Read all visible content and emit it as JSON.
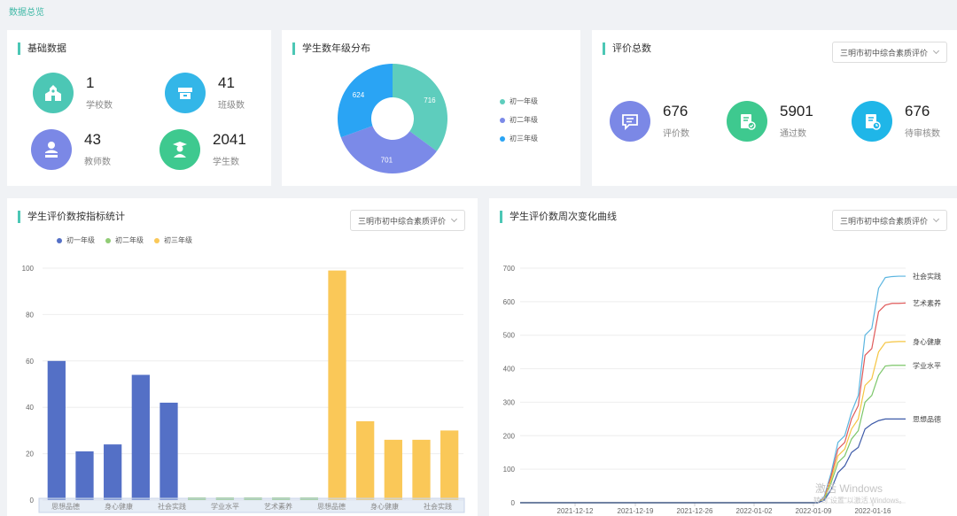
{
  "page": {
    "title": "数据总览"
  },
  "basic": {
    "title": "基础数据",
    "items": [
      {
        "value": "1",
        "label": "学校数",
        "color": "#4cc7b5",
        "icon": "school-icon"
      },
      {
        "value": "41",
        "label": "班级数",
        "color": "#33b6e8",
        "icon": "classroom-icon"
      },
      {
        "value": "43",
        "label": "教师数",
        "color": "#7b88e6",
        "icon": "teacher-icon"
      },
      {
        "value": "2041",
        "label": "学生数",
        "color": "#3ec98f",
        "icon": "student-icon"
      }
    ]
  },
  "distribution": {
    "title": "学生数年级分布",
    "legend": [
      "初一年级",
      "初二年级",
      "初三年级"
    ],
    "chart_data": {
      "type": "pie",
      "labels": [
        "初一年级",
        "初二年级",
        "初三年级"
      ],
      "values": [
        716,
        701,
        624
      ],
      "colors": [
        "#5ecdbd",
        "#7b8ae8",
        "#2aa4f4"
      ]
    }
  },
  "eval": {
    "title": "评价总数",
    "select": "三明市初中综合素质评价",
    "items": [
      {
        "value": "676",
        "label": "评价数",
        "color": "#7b88e6",
        "icon": "comment-icon"
      },
      {
        "value": "5901",
        "label": "通过数",
        "color": "#3ec98f",
        "icon": "approved-doc-icon"
      },
      {
        "value": "676",
        "label": "待审核数",
        "color": "#1fb6e8",
        "icon": "pending-doc-icon"
      }
    ]
  },
  "indicator": {
    "title": "学生评价数按指标统计",
    "select": "三明市初中综合素质评价",
    "chart_data": {
      "type": "bar",
      "categories": [
        "思想品德",
        "身心健康",
        "社会实践",
        "学业水平",
        "艺术素养"
      ],
      "axis_labels": [
        "思想品德",
        "身心健康",
        "社会实践",
        "学业水平",
        "艺术素养",
        "思想品德",
        "身心健康",
        "社会实践"
      ],
      "ylim": [
        0,
        100
      ],
      "yticks": [
        0,
        20,
        40,
        60,
        80,
        100
      ],
      "series": [
        {
          "name": "初一年级",
          "color": "#5470c6",
          "values": [
            60,
            21,
            24,
            54,
            42
          ]
        },
        {
          "name": "初二年级",
          "color": "#91cc75",
          "values": [
            0,
            0,
            0,
            0,
            0
          ]
        },
        {
          "name": "初三年级",
          "color": "#fac858",
          "values": [
            99,
            34,
            26,
            26,
            30
          ]
        }
      ]
    }
  },
  "weekly": {
    "title": "学生评价数周次变化曲线",
    "select": "三明市初中综合素质评价",
    "chart_data": {
      "type": "line",
      "x": [
        "2021-12-12",
        "2021-12-19",
        "2021-12-26",
        "2022-01-02",
        "2022-01-09",
        "2022-01-16"
      ],
      "ylim": [
        0,
        700
      ],
      "yticks": [
        0,
        100,
        200,
        300,
        400,
        500,
        600,
        700
      ],
      "series": [
        {
          "name": "社会实践",
          "color": "#5bb5e0",
          "values": [
            0,
            0,
            0,
            0,
            0,
            0,
            0,
            0,
            0,
            0,
            0,
            0,
            0,
            0,
            0,
            0,
            0,
            0,
            0,
            0,
            0,
            0,
            0,
            0,
            0,
            0,
            0,
            0,
            0,
            0,
            0,
            0,
            0,
            0,
            0,
            0,
            0,
            0,
            0,
            0,
            0,
            0,
            0,
            0,
            0,
            20,
            90,
            180,
            200,
            270,
            320,
            500,
            520,
            640,
            672,
            675,
            676,
            676
          ]
        },
        {
          "name": "艺术素养",
          "color": "#e05a5a",
          "values": [
            0,
            0,
            0,
            0,
            0,
            0,
            0,
            0,
            0,
            0,
            0,
            0,
            0,
            0,
            0,
            0,
            0,
            0,
            0,
            0,
            0,
            0,
            0,
            0,
            0,
            0,
            0,
            0,
            0,
            0,
            0,
            0,
            0,
            0,
            0,
            0,
            0,
            0,
            0,
            0,
            0,
            0,
            0,
            0,
            0,
            15,
            80,
            160,
            180,
            250,
            290,
            440,
            460,
            570,
            590,
            595,
            595,
            596
          ]
        },
        {
          "name": "身心健康",
          "color": "#f5c542",
          "values": [
            0,
            0,
            0,
            0,
            0,
            0,
            0,
            0,
            0,
            0,
            0,
            0,
            0,
            0,
            0,
            0,
            0,
            0,
            0,
            0,
            0,
            0,
            0,
            0,
            0,
            0,
            0,
            0,
            0,
            0,
            0,
            0,
            0,
            0,
            0,
            0,
            0,
            0,
            0,
            0,
            0,
            0,
            0,
            0,
            0,
            12,
            70,
            140,
            160,
            220,
            250,
            350,
            370,
            450,
            478,
            480,
            481,
            481
          ]
        },
        {
          "name": "学业水平",
          "color": "#7cc66a",
          "values": [
            0,
            0,
            0,
            0,
            0,
            0,
            0,
            0,
            0,
            0,
            0,
            0,
            0,
            0,
            0,
            0,
            0,
            0,
            0,
            0,
            0,
            0,
            0,
            0,
            0,
            0,
            0,
            0,
            0,
            0,
            0,
            0,
            0,
            0,
            0,
            0,
            0,
            0,
            0,
            0,
            0,
            0,
            0,
            0,
            0,
            10,
            60,
            120,
            140,
            190,
            215,
            300,
            320,
            380,
            408,
            410,
            410,
            410
          ]
        },
        {
          "name": "思想品德",
          "color": "#3d5aa8",
          "values": [
            0,
            0,
            0,
            0,
            0,
            0,
            0,
            0,
            0,
            0,
            0,
            0,
            0,
            0,
            0,
            0,
            0,
            0,
            0,
            0,
            0,
            0,
            0,
            0,
            0,
            0,
            0,
            0,
            0,
            0,
            0,
            0,
            0,
            0,
            0,
            0,
            0,
            0,
            0,
            0,
            0,
            0,
            0,
            0,
            0,
            8,
            40,
            90,
            110,
            150,
            165,
            220,
            235,
            245,
            250,
            250,
            250,
            250
          ]
        }
      ]
    }
  },
  "watermark": {
    "line1": "激活 Windows",
    "line2": "转到\"设置\"以激活 Windows。"
  }
}
